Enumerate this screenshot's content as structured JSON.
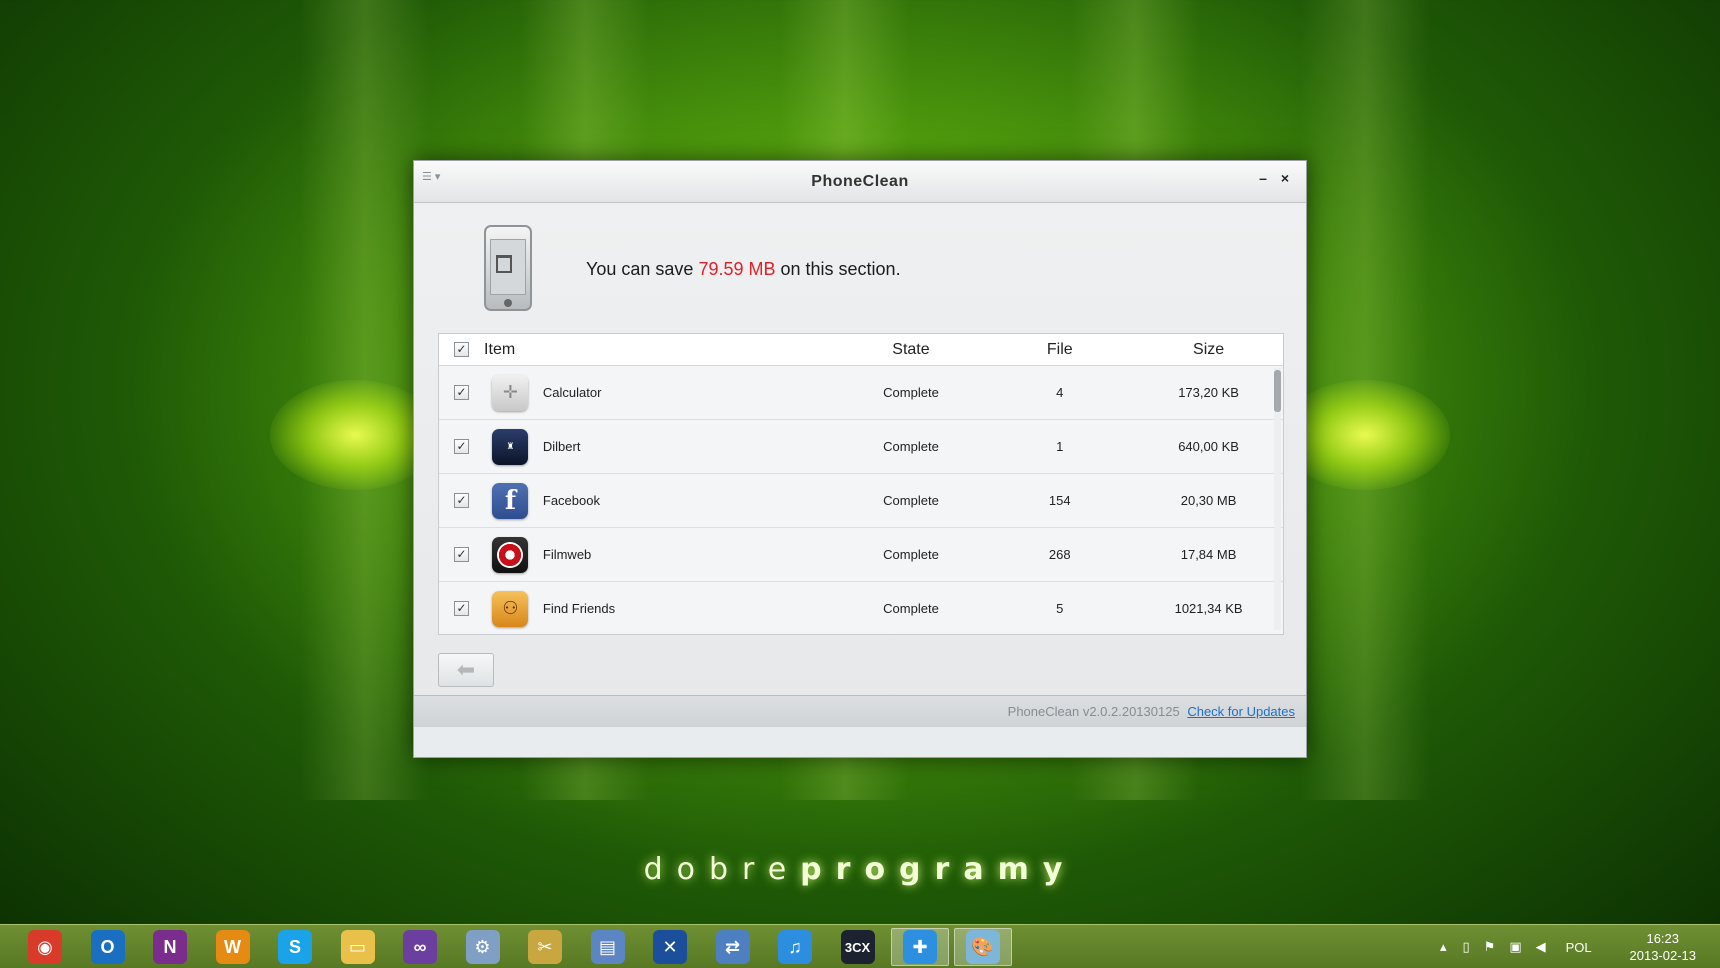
{
  "window": {
    "title": "PhoneClean",
    "menu_icon": "menu-icon",
    "minimize_label": "–",
    "close_label": "×"
  },
  "summary": {
    "prefix": "You can save",
    "amount": "79.59 MB",
    "suffix": "on this section.",
    "amount_color": "#e0202a"
  },
  "table": {
    "headers": {
      "item": "Item",
      "state": "State",
      "file": "File",
      "size": "Size"
    },
    "rows": [
      {
        "name": "Calculator",
        "state": "Complete",
        "files": "4",
        "size": "173,20 KB",
        "icon": "calculator-icon",
        "checked": true
      },
      {
        "name": "Dilbert",
        "state": "Complete",
        "files": "1",
        "size": "640,00 KB",
        "icon": "dilbert-icon",
        "checked": true
      },
      {
        "name": "Facebook",
        "state": "Complete",
        "files": "154",
        "size": "20,30 MB",
        "icon": "facebook-icon",
        "checked": true
      },
      {
        "name": "Filmweb",
        "state": "Complete",
        "files": "268",
        "size": "17,84 MB",
        "icon": "filmweb-icon",
        "checked": true
      },
      {
        "name": "Find Friends",
        "state": "Complete",
        "files": "5",
        "size": "1021,34 KB",
        "icon": "find-friends-icon",
        "checked": true
      }
    ]
  },
  "footer": {
    "version": "PhoneClean v2.0.2.20130125",
    "update_link": "Check for Updates"
  },
  "desktop": {
    "brand_light": "dobre",
    "brand_bold": "programy"
  },
  "taskbar": {
    "apps": [
      {
        "name": "chrome",
        "glyph": "◉",
        "color": "#d93b2b"
      },
      {
        "name": "outlook",
        "glyph": "O",
        "color": "#1a6fc1"
      },
      {
        "name": "onenote",
        "glyph": "N",
        "color": "#7b2d8e"
      },
      {
        "name": "w-app",
        "glyph": "W",
        "color": "#e58a12"
      },
      {
        "name": "skype",
        "glyph": "S",
        "color": "#1aa3e8"
      },
      {
        "name": "file-explorer",
        "glyph": "▭",
        "color": "#e8c04a"
      },
      {
        "name": "visual-studio",
        "glyph": "∞",
        "color": "#6a3fa0"
      },
      {
        "name": "network-tool",
        "glyph": "⚙",
        "color": "#7f9fc4"
      },
      {
        "name": "system-tools",
        "glyph": "✂",
        "color": "#c8a640"
      },
      {
        "name": "remote-desktop",
        "glyph": "▤",
        "color": "#5b86c3"
      },
      {
        "name": "x-app",
        "glyph": "✕",
        "color": "#1b4e9b"
      },
      {
        "name": "network-connect",
        "glyph": "⇄",
        "color": "#4e7fc0"
      },
      {
        "name": "itunes",
        "glyph": "♫",
        "color": "#2d8ee0"
      },
      {
        "name": "3cx",
        "glyph": "3CX",
        "color": "#1d2230"
      },
      {
        "name": "phoneclean",
        "glyph": "✚",
        "color": "#2d8fe0"
      },
      {
        "name": "paint",
        "glyph": "🎨",
        "color": "#7eb6d9"
      }
    ],
    "tray": {
      "language": "POL",
      "time": "16:23",
      "date": "2013-02-13"
    }
  }
}
